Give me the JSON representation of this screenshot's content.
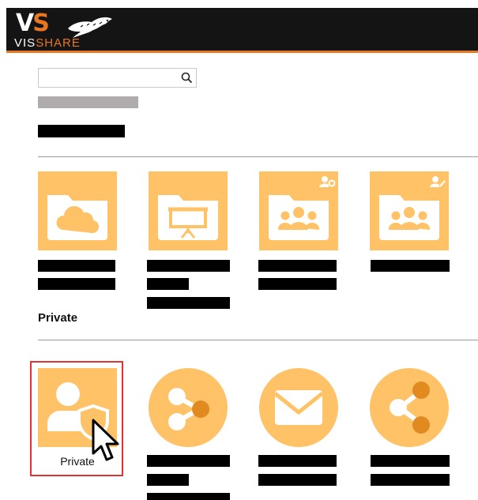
{
  "app": {
    "logo_text_vis": "VIS",
    "logo_text_share": "SHARE",
    "logo_mark": "VS"
  },
  "search": {
    "value": "",
    "placeholder": ""
  },
  "sections": {
    "private_title": "Private"
  },
  "folders_row": [
    {
      "icon": "cloud-folder-icon"
    },
    {
      "icon": "presentation-folder-icon"
    },
    {
      "icon": "group-folder-settings-icon"
    },
    {
      "icon": "group-folder-edit-icon"
    }
  ],
  "private_row": [
    {
      "icon": "private-user-shield-icon",
      "label": "Private"
    },
    {
      "icon": "shared-incoming-icon"
    },
    {
      "icon": "mail-icon"
    },
    {
      "icon": "shared-outgoing-icon"
    }
  ],
  "colors": {
    "tile": "#ffc266",
    "accent": "#e87722",
    "header": "#141414",
    "selection": "#e03535"
  }
}
